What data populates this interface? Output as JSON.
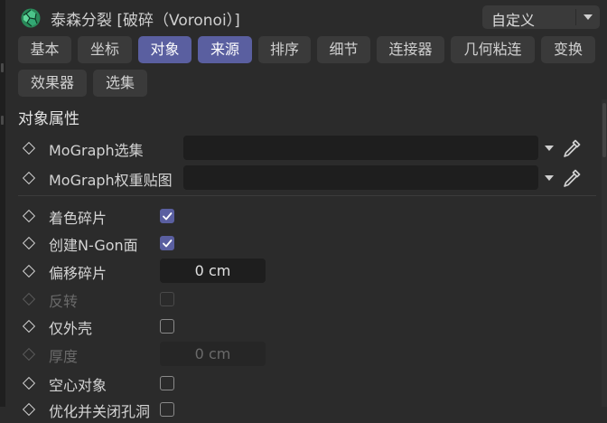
{
  "header": {
    "title": "泰森分裂 [破碎（Voronoi）]",
    "mode_value": "自定义",
    "icon": "voronoi-fracture-icon"
  },
  "tabs": [
    {
      "label": "基本",
      "active": false
    },
    {
      "label": "坐标",
      "active": false
    },
    {
      "label": "对象",
      "active": true
    },
    {
      "label": "来源",
      "active": true
    },
    {
      "label": "排序",
      "active": false
    },
    {
      "label": "细节",
      "active": false
    },
    {
      "label": "连接器",
      "active": false
    },
    {
      "label": "几何粘连",
      "active": false
    },
    {
      "label": "变换",
      "active": false
    },
    {
      "label": "效果器",
      "active": false
    },
    {
      "label": "选集",
      "active": false
    }
  ],
  "section_title": "对象属性",
  "fields": {
    "mograph_selection": {
      "label": "MoGraph选集",
      "value": ""
    },
    "mograph_weightmap": {
      "label": "MoGraph权重贴图",
      "value": ""
    },
    "color_fragments": {
      "label": "着色碎片",
      "checked": true
    },
    "create_ngon": {
      "label": "创建N-Gon面",
      "checked": true
    },
    "offset_fragments": {
      "label": "偏移碎片",
      "value": "0 cm"
    },
    "invert": {
      "label": "反转",
      "checked": false,
      "enabled": false
    },
    "outer_shell_only": {
      "label": "仅外壳",
      "checked": false
    },
    "thickness": {
      "label": "厚度",
      "value": "0 cm",
      "enabled": false
    },
    "hollow_object": {
      "label": "空心对象",
      "checked": false
    },
    "partial_next": {
      "label": "优化并关闭孔洞",
      "checked": false
    }
  },
  "colors": {
    "accent": "#5a5fa0",
    "background": "#2b2b2b",
    "field": "#1e1e1e"
  }
}
